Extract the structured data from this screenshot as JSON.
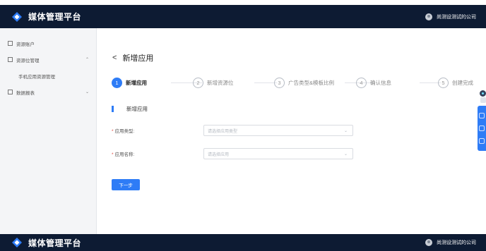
{
  "header": {
    "app_name": "媒体管理平台",
    "account_name": "尚测设测试的公司"
  },
  "footer_bar": {
    "app_name": "媒体管理平台",
    "account_name": "尚测设测试的公司"
  },
  "sidebar": {
    "items": [
      {
        "label": "资源账户",
        "icon": "account-icon"
      },
      {
        "label": "资源位管理",
        "icon": "grid-icon",
        "chevron": "⌃"
      },
      {
        "label": "手机应用资源管理"
      },
      {
        "label": "数据报表",
        "icon": "report-icon",
        "chevron": "⌄"
      }
    ]
  },
  "page": {
    "back_icon": "<",
    "title": "新增应用"
  },
  "steps": [
    {
      "num": "1",
      "label": "新增应用",
      "state": "active"
    },
    {
      "num": "2",
      "label": "新增资源位",
      "state": "pending"
    },
    {
      "num": "3",
      "label": "广告类型&模板比例",
      "state": "pending"
    },
    {
      "num": "4",
      "label": "确认信息",
      "state": "pending"
    },
    {
      "num": "5",
      "label": "创建完成",
      "state": "pending"
    }
  ],
  "section": {
    "title": "新增应用"
  },
  "form": {
    "required_mark": "*",
    "fields": [
      {
        "label": "应用类型:",
        "placeholder": "请选择应用类型"
      },
      {
        "label": "应用名称:",
        "placeholder": "请选择应用"
      }
    ]
  },
  "next_button": "下一步",
  "colors": {
    "primary": "#2e7cf6",
    "topbar": "#0d1b33",
    "sidebar": "#f4f5f7"
  }
}
